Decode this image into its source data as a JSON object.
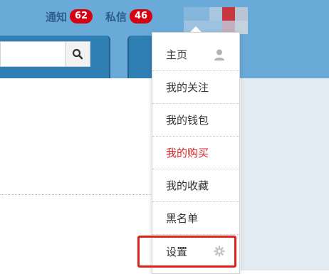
{
  "header": {
    "notifications": {
      "label": "通知",
      "count": "62"
    },
    "messages": {
      "label": "私信",
      "count": "46"
    },
    "avatar_colors": [
      "#85b7dc",
      "#85b7dc",
      "#a9c8e0",
      "#c9363f",
      "#b9c4d4",
      "#9cc2df",
      "#9cc2df",
      "#9cc2df",
      "#c5b0bf",
      "#c4d2de"
    ]
  },
  "search": {
    "value": "",
    "placeholder": ""
  },
  "menu": {
    "items": [
      {
        "label": "主页",
        "icon": "user-icon"
      },
      {
        "label": "我的关注"
      },
      {
        "label": "我的钱包"
      },
      {
        "label": "我的购买",
        "color": "#d8262a"
      },
      {
        "label": "我的收藏"
      },
      {
        "label": "黑名单"
      },
      {
        "label": "设置",
        "icon": "gear-icon"
      }
    ]
  },
  "colors": {
    "topbar": "#6aaad8",
    "badge": "#d60010",
    "nav_blue": "#2f7fb5",
    "highlight": "#e0201a"
  }
}
